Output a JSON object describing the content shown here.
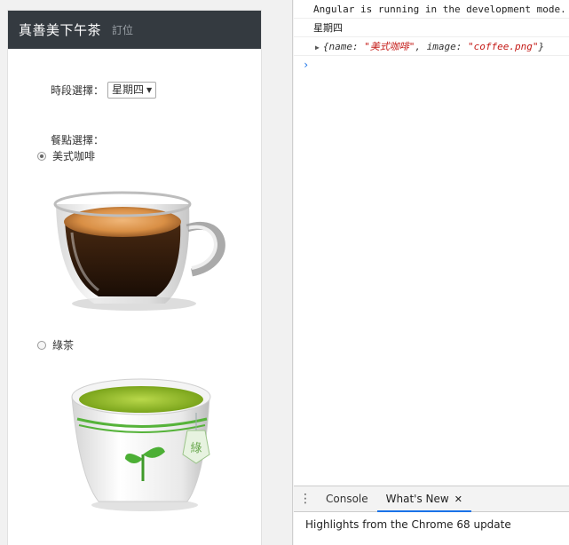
{
  "app": {
    "brand": "真善美下午茶",
    "nav_order": "訂位",
    "time_label": "時段選擇：",
    "time_selected": "星期四",
    "meal_label": "餐點選擇：",
    "options": [
      {
        "label": "美式咖啡",
        "checked": true
      },
      {
        "label": "綠茶",
        "checked": false
      }
    ]
  },
  "devtools": {
    "log_angular": "Angular is running in the development mode. Call enableProdMode() to enable production mode.",
    "log_day": "星期四",
    "log_obj_open": "{name: ",
    "log_obj_name": "\"美式咖啡\"",
    "log_obj_mid": ", image: ",
    "log_obj_image": "\"coffee.png\"",
    "log_obj_close": "}",
    "prompt": "›",
    "tab_console": "Console",
    "tab_whats_new": "What's New",
    "close_glyph": "✕",
    "kebab": "⋮",
    "drawer_text": "Highlights from the Chrome 68 update"
  },
  "colors": {
    "navbar": "#343a40",
    "accent": "#1a73e8",
    "string": "#c41a16"
  }
}
